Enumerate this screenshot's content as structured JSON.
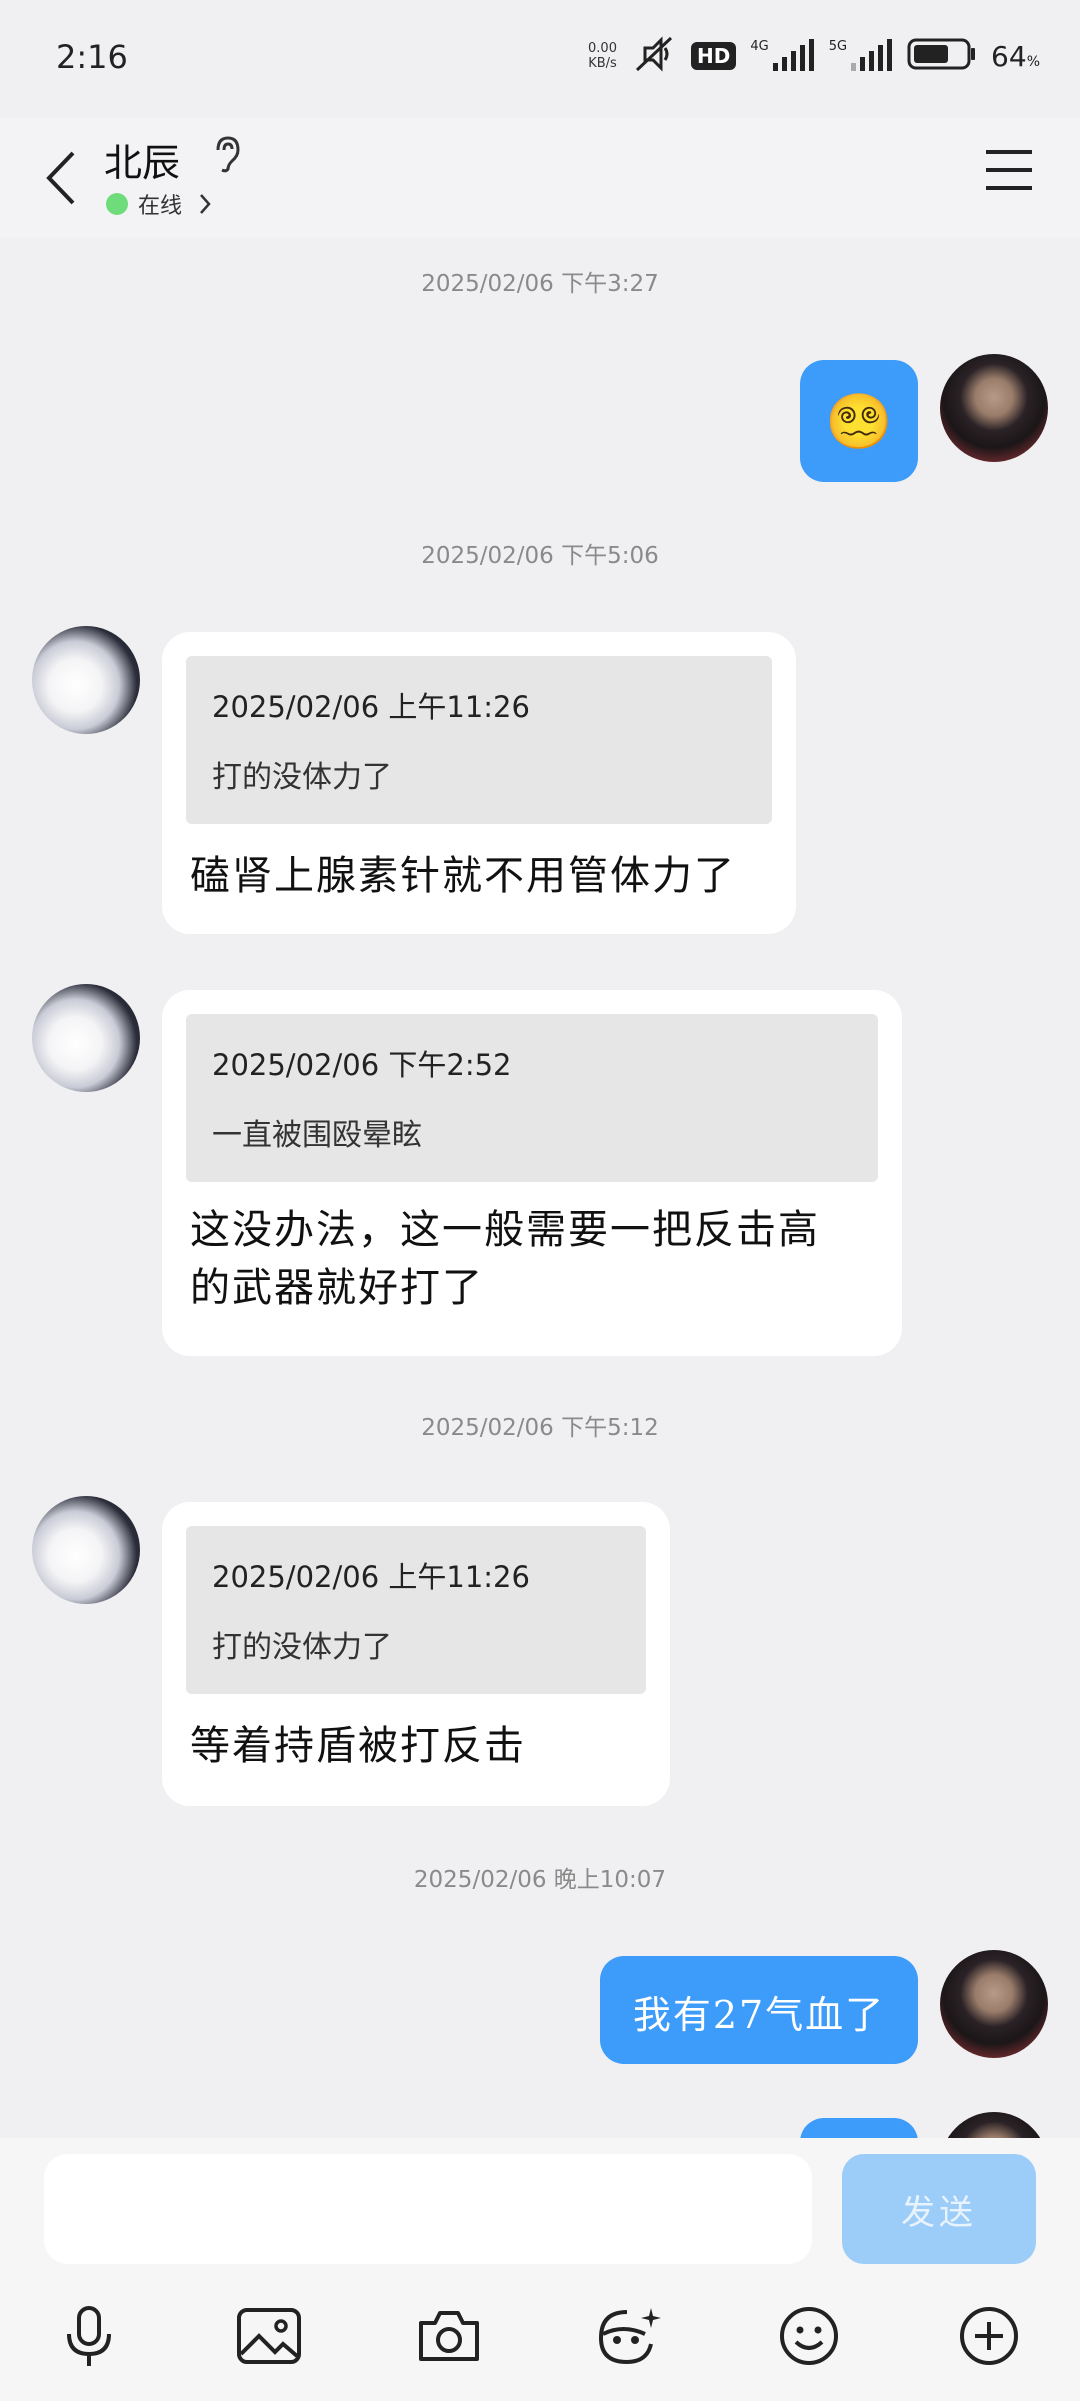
{
  "status_bar": {
    "time": "2:16",
    "net_speed_value": "0.00",
    "net_speed_unit": "KB/s",
    "hd_label": "HD",
    "network_4g": "4G",
    "network_5g": "5G",
    "battery_percent": "64",
    "battery_unit": "%"
  },
  "header": {
    "contact_name": "北辰",
    "status_text": "在线",
    "status_color": "#6edc7a"
  },
  "messages": [
    {
      "type": "timestamp",
      "text": "2025/02/06 下午3:27"
    },
    {
      "type": "sent_emoji",
      "emoji": "😵‍💫",
      "from": "me"
    },
    {
      "type": "timestamp",
      "text": "2025/02/06 下午5:06"
    },
    {
      "type": "received_quote",
      "quote_time": "2025/02/06 上午11:26",
      "quote_text": "打的没体力了",
      "reply": "磕肾上腺素针就不用管体力了"
    },
    {
      "type": "received_quote",
      "quote_time": "2025/02/06 下午2:52",
      "quote_text": "一直被围殴晕眩",
      "reply_line1": "这没办法，这一般需要一把反击高",
      "reply_line2": "的武器就好打了"
    },
    {
      "type": "timestamp",
      "text": "2025/02/06 下午5:12"
    },
    {
      "type": "received_quote",
      "quote_time": "2025/02/06 上午11:26",
      "quote_text": "打的没体力了",
      "reply": "等着持盾被打反击"
    },
    {
      "type": "timestamp",
      "text": "2025/02/06 晚上10:07"
    },
    {
      "type": "sent_text",
      "text": "我有27气血了"
    }
  ],
  "composer": {
    "input_value": "",
    "send_label": "发送"
  },
  "toolbar": [
    "microphone-icon",
    "image-icon",
    "camera-icon",
    "sticker-icon",
    "emoji-icon",
    "plus-icon"
  ],
  "colors": {
    "bubble_blue": "#3d9bfa",
    "send_disabled": "#9ccdf8",
    "background": "#f0f0f2"
  }
}
